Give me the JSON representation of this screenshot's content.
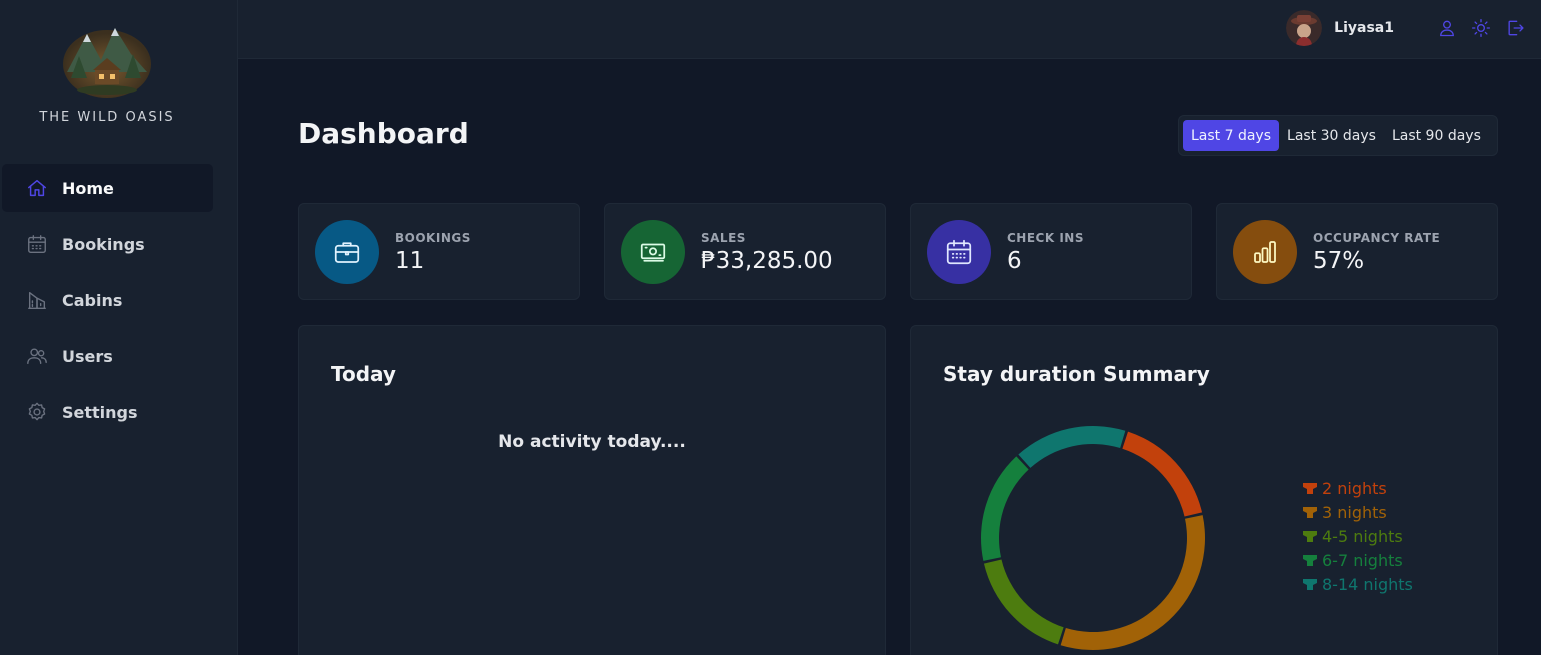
{
  "brand": {
    "name": "THE WILD OASIS"
  },
  "sidebar": {
    "items": [
      {
        "label": "Home",
        "icon": "home-icon",
        "active": true
      },
      {
        "label": "Bookings",
        "icon": "calendar-icon"
      },
      {
        "label": "Cabins",
        "icon": "cabins-icon"
      },
      {
        "label": "Users",
        "icon": "users-icon"
      },
      {
        "label": "Settings",
        "icon": "settings-icon"
      }
    ]
  },
  "header": {
    "user_name": "Liyasa1",
    "icons": [
      "user-icon",
      "sun-icon",
      "logout-icon"
    ]
  },
  "page": {
    "title": "Dashboard",
    "filters": [
      "Last 7 days",
      "Last 30 days",
      "Last 90 days"
    ],
    "active_filter": "Last 7 days"
  },
  "stats": [
    {
      "label": "BOOKINGS",
      "value": "11",
      "icon": "briefcase-icon",
      "color": "#075985"
    },
    {
      "label": "SALES",
      "value": "₱33,285.00",
      "icon": "banknotes-icon",
      "color": "#166534"
    },
    {
      "label": "CHECK INS",
      "value": "6",
      "icon": "calendar-days-icon",
      "color": "#3730a3"
    },
    {
      "label": "OCCUPANCY RATE",
      "value": "57%",
      "icon": "chart-bar-icon",
      "color": "#854d0e"
    }
  ],
  "today": {
    "title": "Today",
    "empty_message": "No activity today...."
  },
  "duration": {
    "title": "Stay duration Summary"
  },
  "chart_data": {
    "type": "pie",
    "categories": [
      "2 nights",
      "3 nights",
      "4-5 nights",
      "6-7 nights",
      "8-14 nights"
    ],
    "values": [
      2,
      4,
      2,
      2,
      2
    ],
    "colors": [
      "#c2410c",
      "#a16207",
      "#4d7c0f",
      "#15803d",
      "#0f766e"
    ],
    "legend": "right"
  }
}
